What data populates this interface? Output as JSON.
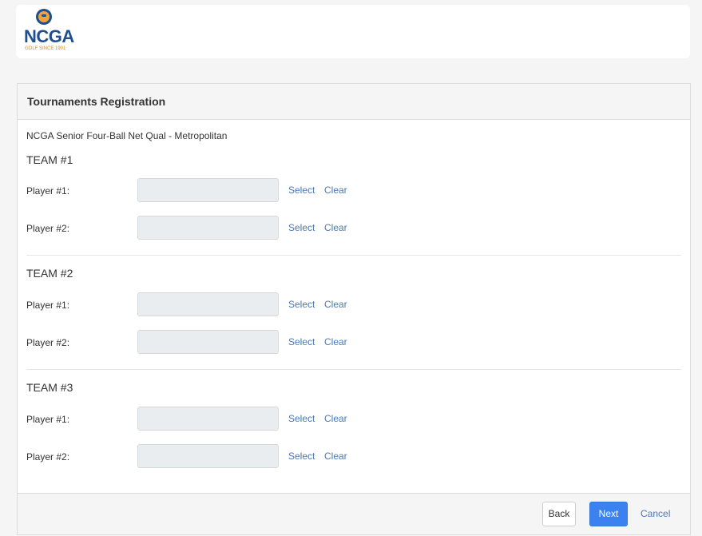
{
  "header": {
    "logo_text": "NCGA",
    "logo_subtext": "GOLF SINCE 1901"
  },
  "panel": {
    "title": "Tournaments Registration",
    "tournament_name": "NCGA Senior Four-Ball Net Qual - Metropolitan",
    "teams": [
      {
        "title": "TEAM #1",
        "players": [
          {
            "label": "Player #1:",
            "value": "",
            "select_label": "Select",
            "clear_label": "Clear"
          },
          {
            "label": "Player #2:",
            "value": "",
            "select_label": "Select",
            "clear_label": "Clear"
          }
        ]
      },
      {
        "title": "TEAM #2",
        "players": [
          {
            "label": "Player #1:",
            "value": "",
            "select_label": "Select",
            "clear_label": "Clear"
          },
          {
            "label": "Player #2:",
            "value": "",
            "select_label": "Select",
            "clear_label": "Clear"
          }
        ]
      },
      {
        "title": "TEAM #3",
        "players": [
          {
            "label": "Player #1:",
            "value": "",
            "select_label": "Select",
            "clear_label": "Clear"
          },
          {
            "label": "Player #2:",
            "value": "",
            "select_label": "Select",
            "clear_label": "Clear"
          }
        ]
      }
    ]
  },
  "footer": {
    "back_label": "Back",
    "next_label": "Next",
    "cancel_label": "Cancel"
  },
  "colors": {
    "brand_blue": "#1f4f8f",
    "brand_orange": "#f0a23b",
    "link": "#4a78b5",
    "primary_button": "#3b82f0"
  }
}
